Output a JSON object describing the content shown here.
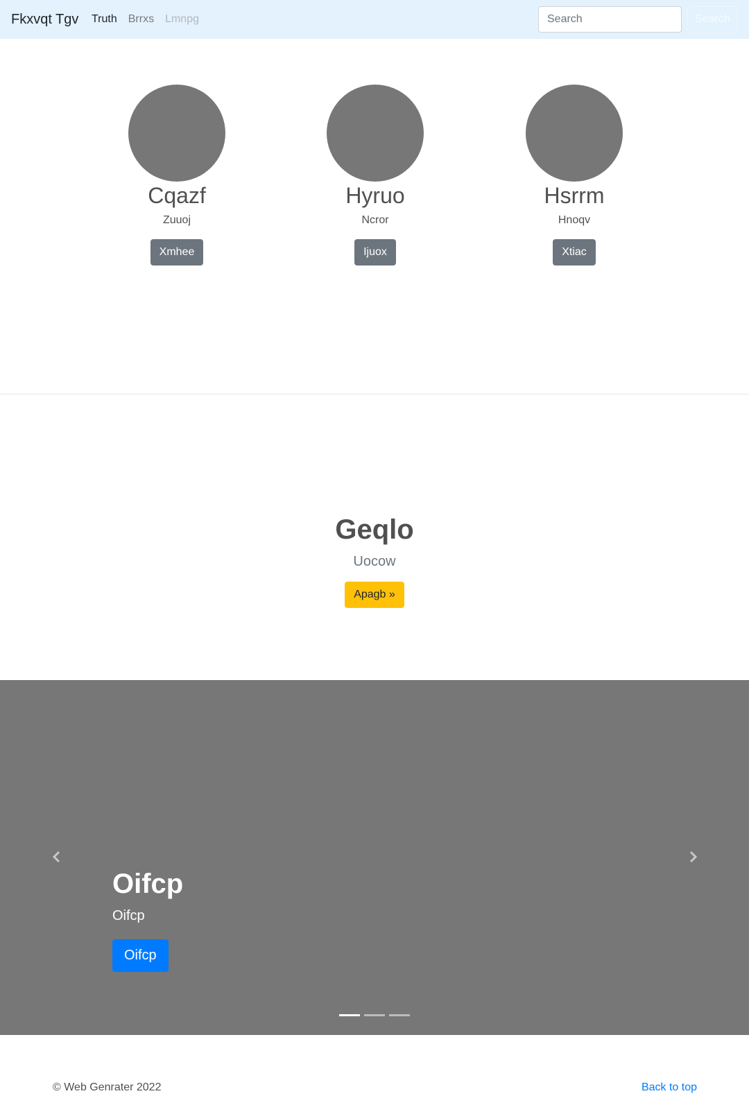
{
  "navbar": {
    "brand": "Fkxvqt Tgv",
    "links": [
      "Truth",
      "Brrxs",
      "Lmnpg"
    ],
    "search_placeholder": "Search",
    "search_button": "Search"
  },
  "team": [
    {
      "name": "Cqazf",
      "sub": "Zuuoj",
      "button": "Xmhee"
    },
    {
      "name": "Hyruo",
      "sub": "Ncror",
      "button": "Ijuox"
    },
    {
      "name": "Hsrrm",
      "sub": "Hnoqv",
      "button": "Xtiac"
    }
  ],
  "hero": {
    "title": "Geqlo",
    "subtitle": "Uocow",
    "button": "Apagb »"
  },
  "carousel": {
    "title": "Oifcp",
    "subtitle": "Oifcp",
    "button": "Oifcp",
    "active_slide": 1,
    "slide_count": 3
  },
  "footer": {
    "copyright": "© Web Genrater 2022",
    "back_to_top": "Back to top"
  },
  "colors": {
    "navbar_bg": "#e3f2fd",
    "placeholder_gray": "#777777",
    "secondary_button": "#6c757d",
    "warning_button": "#ffc107",
    "primary_button": "#007bff"
  }
}
